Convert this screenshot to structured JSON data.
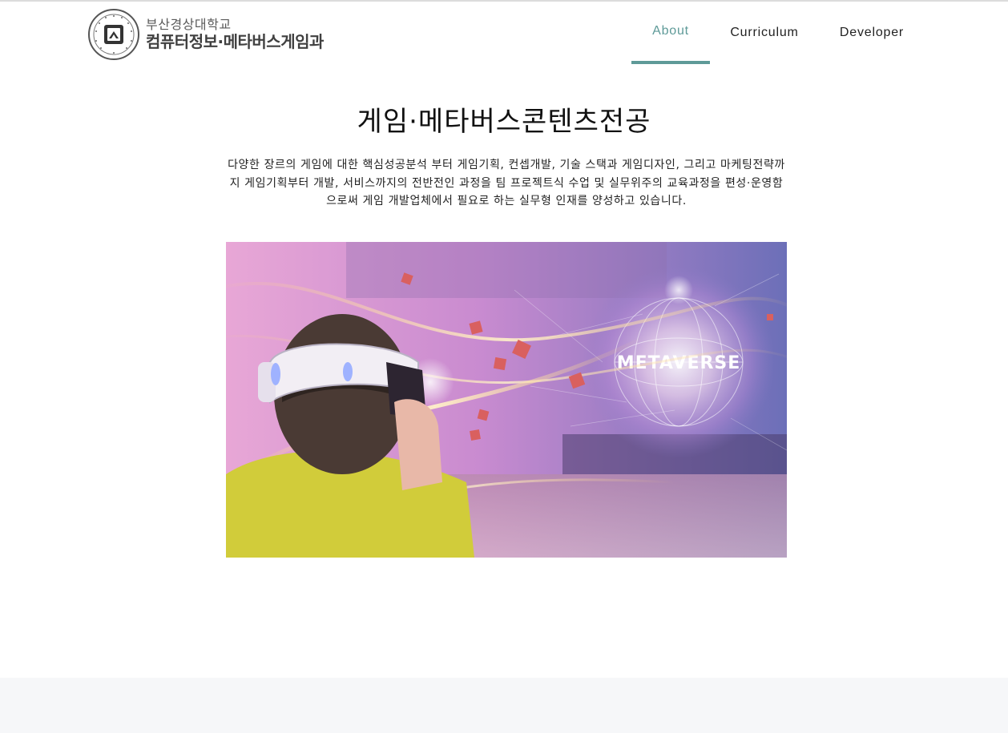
{
  "header": {
    "logo": {
      "line1": "부산경상대학교",
      "line2": "컴퓨터정보·메타버스게임과",
      "seal_text": "부산경상대학교 BUSAN KYUNGSANG COLLEGE"
    },
    "nav": [
      {
        "label": "About",
        "active": true
      },
      {
        "label": "Curriculum",
        "active": false
      },
      {
        "label": "Developer",
        "active": false
      }
    ]
  },
  "main": {
    "title": "게임·메타버스콘텐츠전공",
    "description": "다양한 장르의 게임에 대한 핵심성공분석 부터 게임기획, 컨셉개발, 기술 스택과 게임디자인, 그리고 마케팅전략까지 게임기획부터 개발, 서비스까지의 전반전인 과정을 팀 프로젝트식 수업 및 실무위주의 교육과정을 편성·운영함으로써 게임 개발업체에서 필요로 하는 실무형 인재를 양성하고 있습니다.",
    "hero_text": "METAVERSE"
  },
  "colors": {
    "accent": "#5e9a98",
    "footer_bg": "#f6f7f9"
  }
}
